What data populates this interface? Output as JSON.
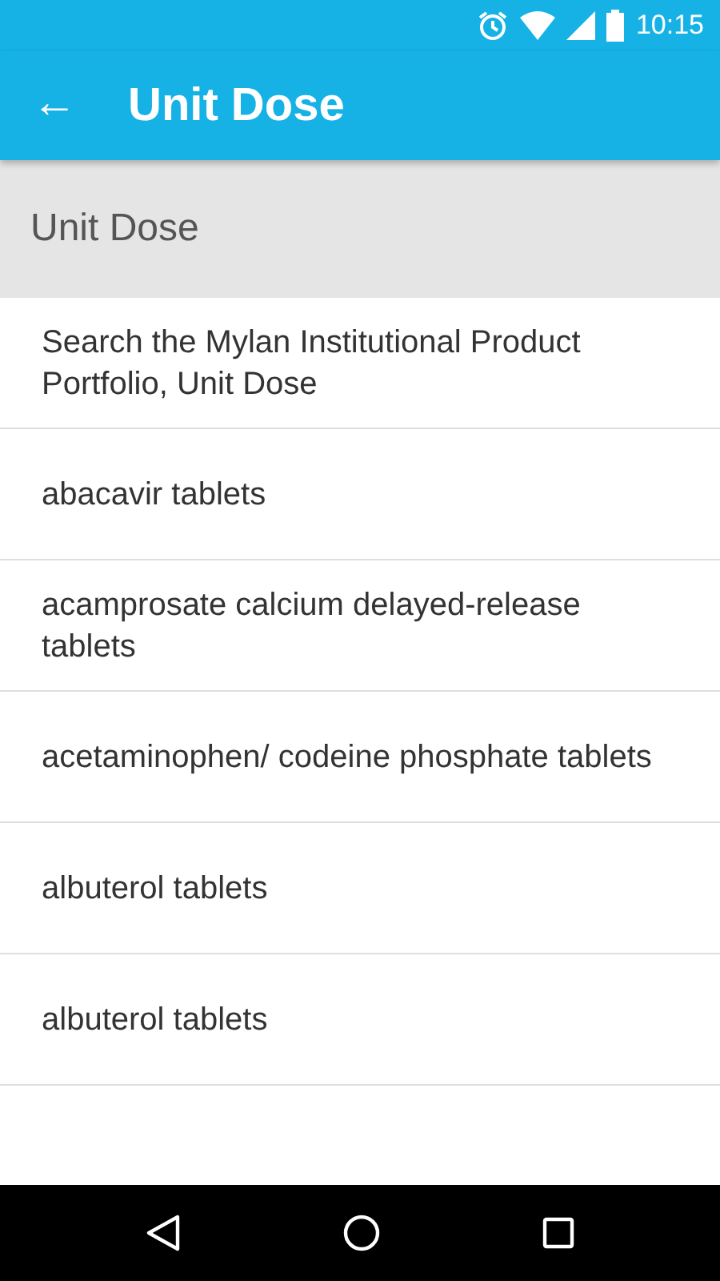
{
  "status_bar": {
    "time": "10:15"
  },
  "app_bar": {
    "back": "←",
    "title": "Unit Dose"
  },
  "section_header": "Unit Dose",
  "items": [
    {
      "label": "Search the Mylan Institutional Product Portfolio, Unit Dose"
    },
    {
      "label": "abacavir tablets"
    },
    {
      "label": "acamprosate calcium delayed-release tablets"
    },
    {
      "label": "acetaminophen/ codeine phosphate tablets"
    },
    {
      "label": "albuterol tablets"
    },
    {
      "label": "albuterol tablets"
    }
  ]
}
